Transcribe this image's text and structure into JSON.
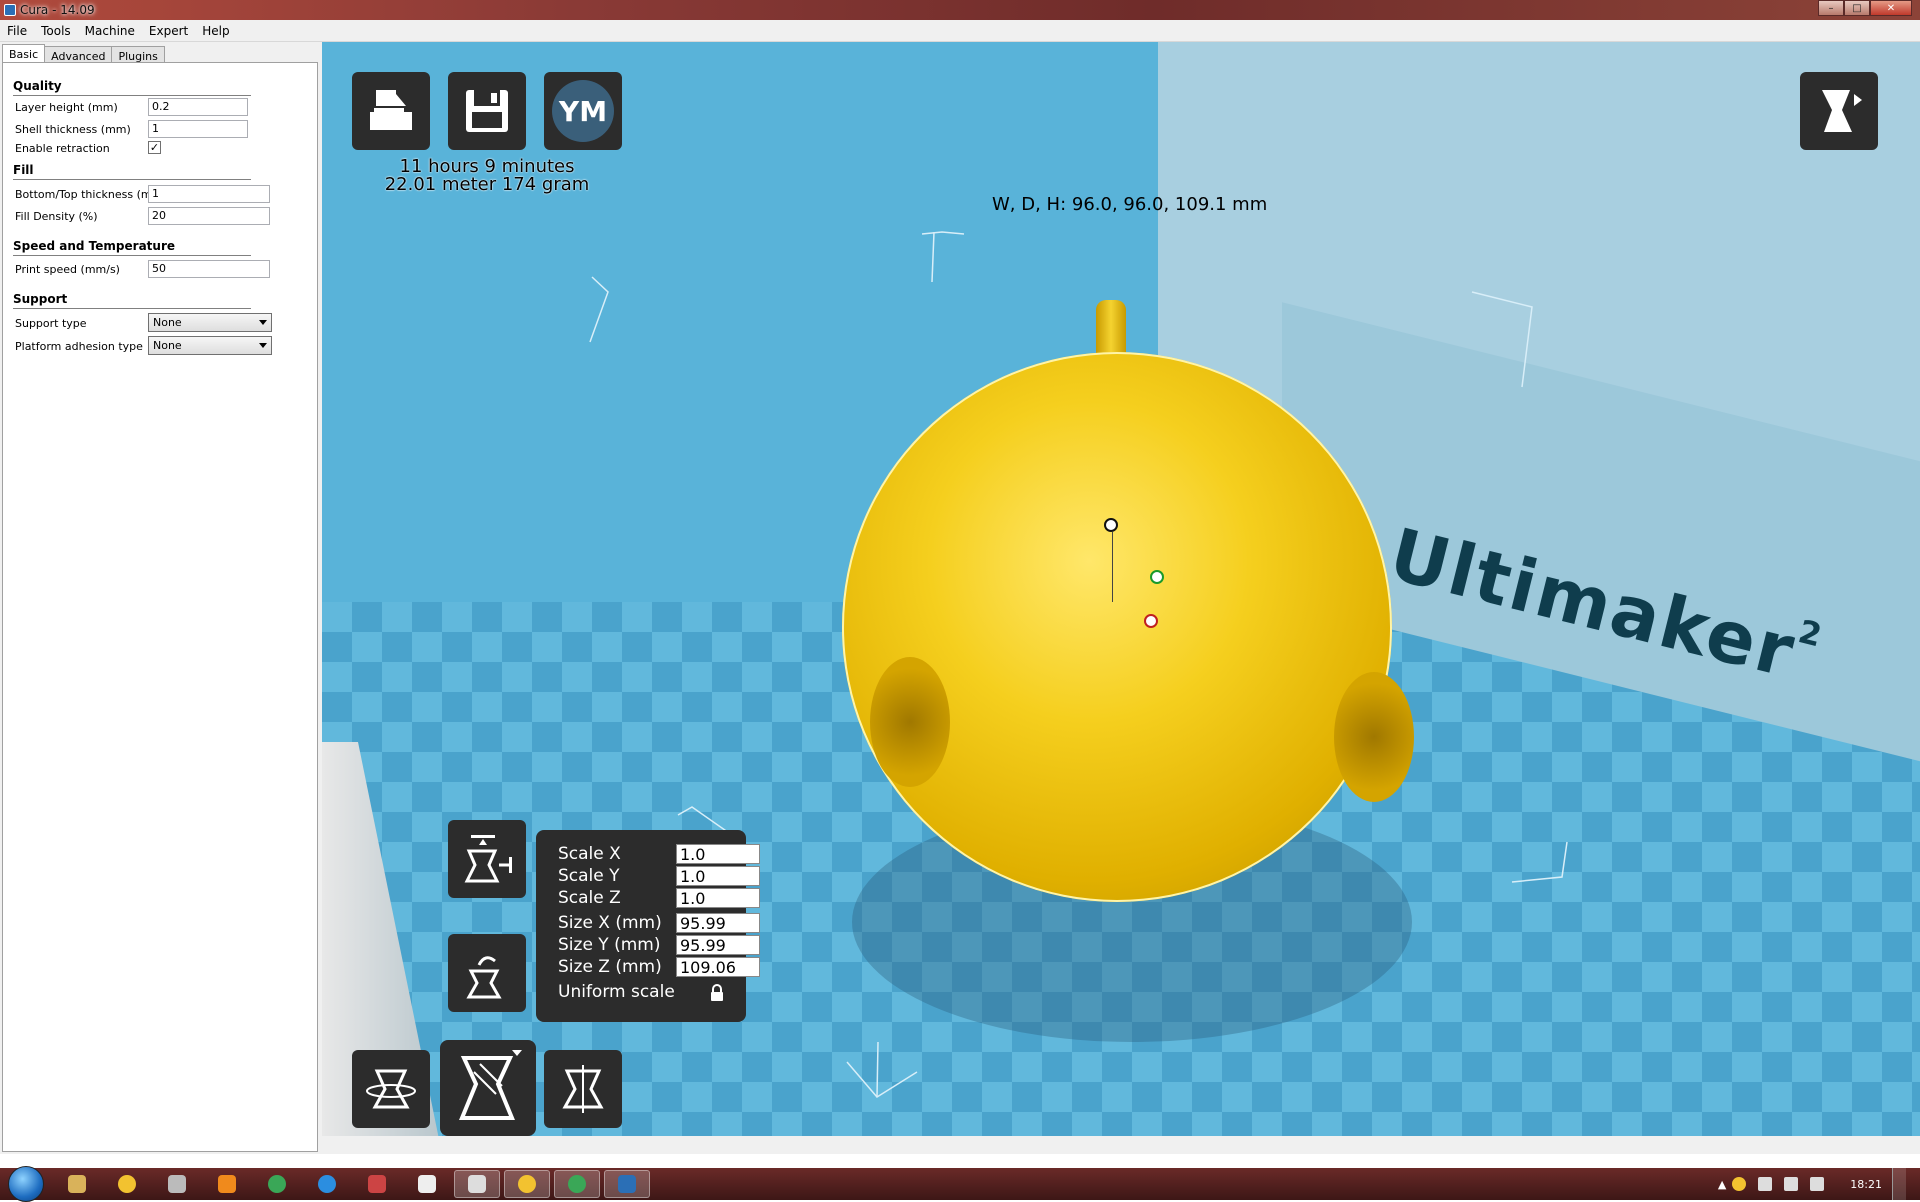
{
  "window": {
    "title": "Cura - 14.09",
    "buttons": [
      "–",
      "□",
      "✕"
    ]
  },
  "menu": [
    "File",
    "Tools",
    "Machine",
    "Expert",
    "Help"
  ],
  "tabs": [
    "Basic",
    "Advanced",
    "Plugins"
  ],
  "settings": {
    "quality": {
      "title": "Quality",
      "layer_height_label": "Layer height (mm)",
      "layer_height": "0.2",
      "shell_thickness_label": "Shell thickness (mm)",
      "shell_thickness": "1",
      "enable_retraction_label": "Enable retraction",
      "enable_retraction": "✓"
    },
    "fill": {
      "title": "Fill",
      "bottom_top_label": "Bottom/Top thickness (mm)",
      "bottom_top": "1",
      "fill_density_label": "Fill Density (%)",
      "fill_density": "20"
    },
    "speed": {
      "title": "Speed and Temperature",
      "print_speed_label": "Print speed (mm/s)",
      "print_speed": "50"
    },
    "support": {
      "title": "Support",
      "support_type_label": "Support type",
      "support_type": "None",
      "platform_adhesion_label": "Platform adhesion type",
      "platform_adhesion": "None"
    }
  },
  "viewport": {
    "print_time": "11 hours 9 minutes",
    "material": "22.01 meter 174 gram",
    "dimensions": "W, D, H: 96.0, 96.0, 109.1 mm",
    "ym_label": "YM",
    "brand": "Ultimaker",
    "brand_sup": "2",
    "scale": {
      "scale_x_label": "Scale X",
      "scale_x": "1.0",
      "scale_y_label": "Scale Y",
      "scale_y": "1.0",
      "scale_z_label": "Scale Z",
      "scale_z": "1.0",
      "size_x_label": "Size X (mm)",
      "size_x": "95.99",
      "size_y_label": "Size Y (mm)",
      "size_y": "95.99",
      "size_z_label": "Size Z (mm)",
      "size_z": "109.06",
      "uniform_label": "Uniform scale"
    }
  },
  "taskbar": {
    "clock": "18:21"
  },
  "colors": {
    "viewport_bg": "#56b0d6",
    "model": "#f5cf1e",
    "toolbar": "#2c2c2c"
  }
}
